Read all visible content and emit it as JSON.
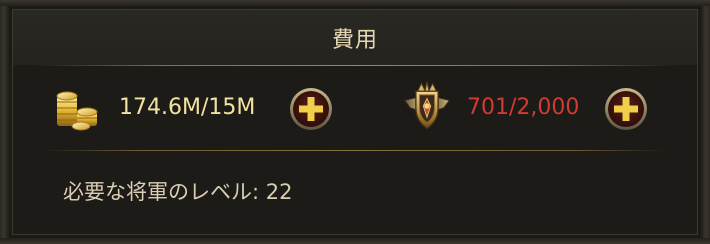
{
  "header": {
    "title": "費用"
  },
  "costs": [
    {
      "icon": "gold-coins-icon",
      "value": "174.6M/15M",
      "value_color": "#f3e2a0",
      "sufficient": true
    },
    {
      "icon": "medal-emblem-icon",
      "value": "701/2,000",
      "value_color": "#d23a33",
      "sufficient": false
    }
  ],
  "requirement": {
    "text": "必要な将軍のレベル: 22"
  }
}
